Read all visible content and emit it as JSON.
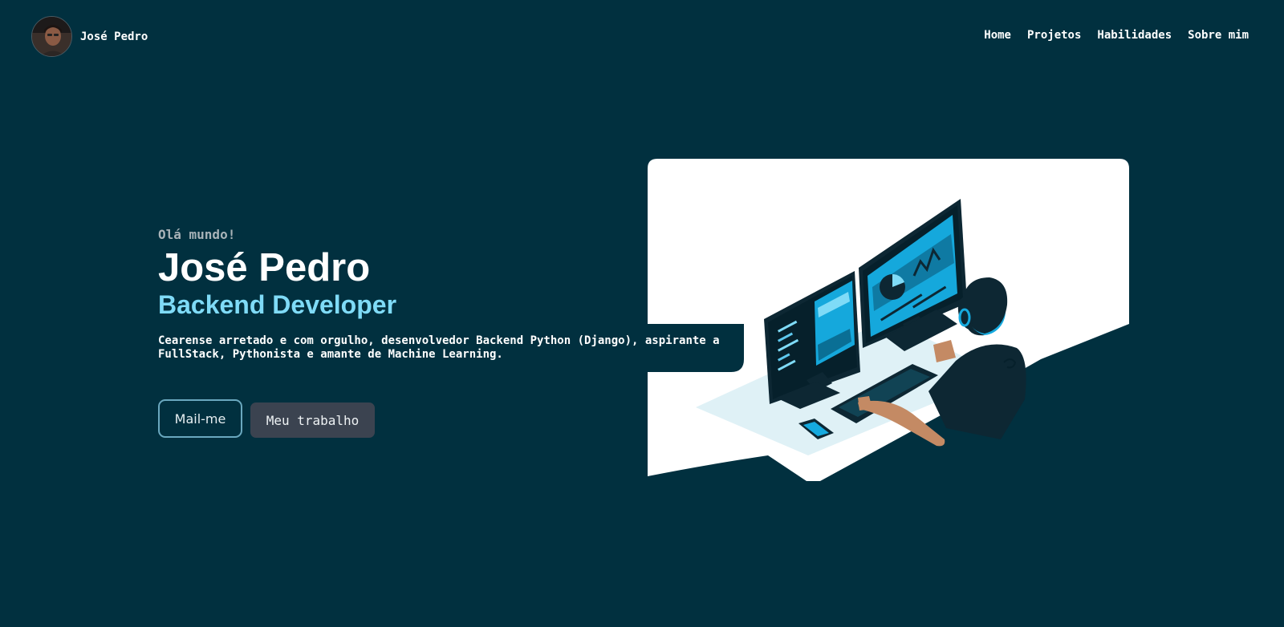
{
  "navbar": {
    "brand_name": "José Pedro",
    "links": [
      {
        "label": "Home"
      },
      {
        "label": "Projetos"
      },
      {
        "label": "Habilidades"
      },
      {
        "label": "Sobre mim"
      }
    ]
  },
  "hero": {
    "greeting": "Olá mundo!",
    "name": "José Pedro",
    "role": "Backend Developer",
    "description": "Cearense arretado e com orgulho, desenvolvedor Backend Python (Django), aspirante a FullStack, Pythonista e amante de Machine Learning."
  },
  "buttons": {
    "mail_label": "Mail-me",
    "work_label": "Meu trabalho"
  },
  "colors": {
    "background": "#01303f",
    "accent": "#7fdbf7",
    "button_secondary": "#3b4350",
    "illustration_screen": "#16aadf"
  },
  "icons": {
    "avatar": "profile-photo",
    "illustration": "developer-at-computer-illustration"
  }
}
